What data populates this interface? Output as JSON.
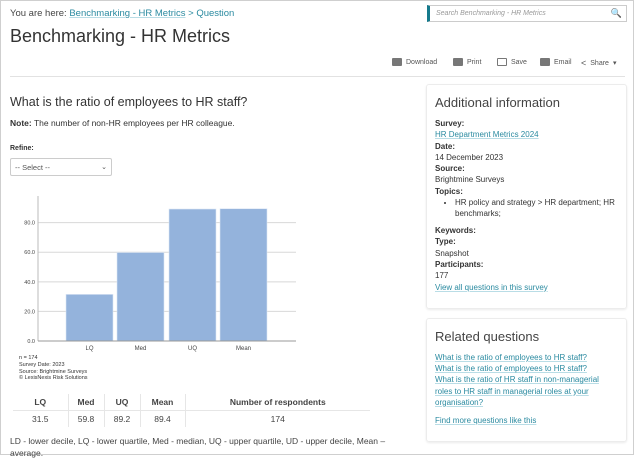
{
  "breadcrumb": {
    "prefix": "You are here: ",
    "link": "Benchmarking - HR Metrics",
    "sep": " > ",
    "current": "Question"
  },
  "search": {
    "placeholder": "Search Benchmarking - HR Metrics",
    "icon": "search-icon"
  },
  "title": "Benchmarking - HR Metrics",
  "toolbar": {
    "download": "Download",
    "print": "Print",
    "save": "Save",
    "email": "Email",
    "share": "Share"
  },
  "question": "What is the ratio of employees to HR staff?",
  "note": {
    "label": "Note:",
    "text": " The number of non-HR employees per HR colleague."
  },
  "refine": {
    "label": "Refine:",
    "selected": "-- Select --"
  },
  "chart_data": {
    "type": "bar",
    "categories": [
      "LQ",
      "Med",
      "UQ",
      "Mean"
    ],
    "values": [
      31.5,
      59.8,
      89.2,
      89.4
    ],
    "ylim": [
      0,
      98
    ],
    "yticks": [
      "0.0",
      "20.0",
      "40.0",
      "60.0",
      "80.0"
    ],
    "grid": true,
    "color": "#94b3dc"
  },
  "chart_meta": [
    "n = 174",
    "Survey Date: 2023",
    "Source: Brightmine Surveys",
    "© LexisNexis Risk Solutions"
  ],
  "table": {
    "headers": [
      "LQ",
      "Med",
      "UQ",
      "Mean",
      "Number of respondents"
    ],
    "row": [
      "31.5",
      "59.8",
      "89.2",
      "89.4",
      "174"
    ]
  },
  "legend": "LD - lower decile, LQ - lower quartile, Med - median, UQ - upper quartile, UD - upper decile, Mean – average.",
  "additional": {
    "title": "Additional information",
    "survey_label": "Survey:",
    "survey": "HR Department Metrics 2024",
    "date_label": "Date:",
    "date": "14 December 2023",
    "source_label": "Source:",
    "source": "Brightmine Surveys",
    "topics_label": "Topics:",
    "topics": [
      "HR policy and strategy > HR department; HR benchmarks;"
    ],
    "keywords_label": "Keywords:",
    "type_label": "Type:",
    "type": "Snapshot",
    "participants_label": "Participants:",
    "participants": "177",
    "view_all": "View all questions in this survey"
  },
  "related": {
    "title": "Related questions",
    "items": [
      "What is the ratio of employees to HR staff?",
      "What is the ratio of employees to HR staff?",
      "What is the ratio of HR staff in non-managerial roles to HR staff in managerial roles at your organisation?"
    ],
    "more": "Find more questions like this"
  }
}
